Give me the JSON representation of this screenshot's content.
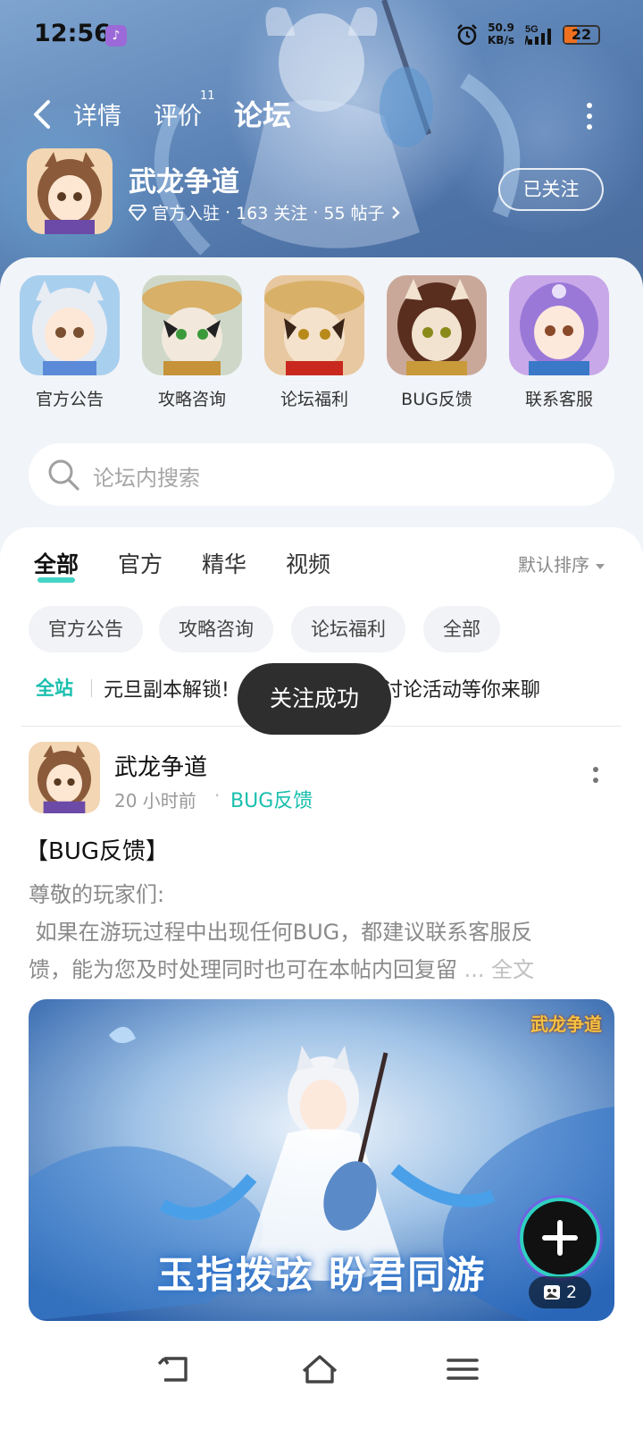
{
  "status_bar": {
    "time": "12:56",
    "net_speed_value": "50.9",
    "net_speed_unit": "KB/s",
    "signal": "5G",
    "battery": "22"
  },
  "nav": {
    "tabs": [
      {
        "label": "详情"
      },
      {
        "label": "评价",
        "badge": "11"
      },
      {
        "label": "论坛"
      }
    ]
  },
  "game": {
    "title": "武龙争道",
    "meta_official": "官方入驻",
    "meta_follows": "163 关注",
    "meta_posts": "55 帖子",
    "follow_button": "已关注"
  },
  "shortcuts": [
    {
      "label": "官方公告"
    },
    {
      "label": "攻略咨询"
    },
    {
      "label": "论坛福利"
    },
    {
      "label": "BUG反馈"
    },
    {
      "label": "联系客服"
    }
  ],
  "search": {
    "placeholder": "论坛内搜索"
  },
  "content_tabs": [
    {
      "label": "全部"
    },
    {
      "label": "官方"
    },
    {
      "label": "精华"
    },
    {
      "label": "视频"
    }
  ],
  "sort_label": "默认排序",
  "chips": [
    {
      "label": "官方公告"
    },
    {
      "label": "攻略咨询"
    },
    {
      "label": "论坛福利"
    },
    {
      "label": "全部"
    }
  ],
  "notice": {
    "tag": "全站",
    "text_before": "元旦副本解锁!",
    "text_after": "题讨论活动等你来聊"
  },
  "toast": "关注成功",
  "post": {
    "author": "武龙争道",
    "time": "20 小时前",
    "category": "BUG反馈",
    "title": "【BUG反馈】",
    "line1": "尊敬的玩家们:",
    "line2": " 如果在游玩过程中出现任何BUG，都建议联系客服反",
    "line3": "馈，能为您及时处理同时也可在本帖内回复留",
    "more": " ... 全文",
    "image_slogan": "玉指拨弦 盼君同游",
    "image_logo": "武龙争道",
    "image_count": "2"
  },
  "colors": {
    "accent": "#2fd0c0",
    "tag_green": "#19bfae"
  }
}
